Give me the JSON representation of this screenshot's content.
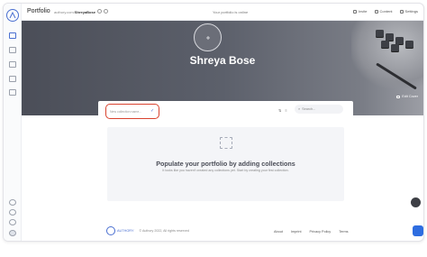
{
  "app": {
    "brand": "Portfolio"
  },
  "url": {
    "prefix": "authory.com/",
    "handle": "ShreyaBose"
  },
  "status": {
    "text": "Your portfolio is online"
  },
  "topnav": {
    "invite": "Invite",
    "content": "Content",
    "settings": "Settings"
  },
  "profile": {
    "name": "Shreya Bose",
    "edit_cover": "Edit Cover"
  },
  "collection_input": {
    "placeholder": "New collection name..."
  },
  "search": {
    "placeholder": "Search..."
  },
  "empty_state": {
    "title": "Populate your portfolio by adding collections",
    "subtitle": "It looks like you haven't created any collections yet. Start by creating your first collection."
  },
  "footer": {
    "brand": "AUTHORY",
    "copyright": "© Authory 2022, All rights reserved",
    "links": [
      "About",
      "Imprint",
      "Privacy Policy",
      "Terms"
    ]
  },
  "colors": {
    "accent": "#4a6fd1",
    "highlight": "#d9432f",
    "cover": "#5c606b"
  }
}
